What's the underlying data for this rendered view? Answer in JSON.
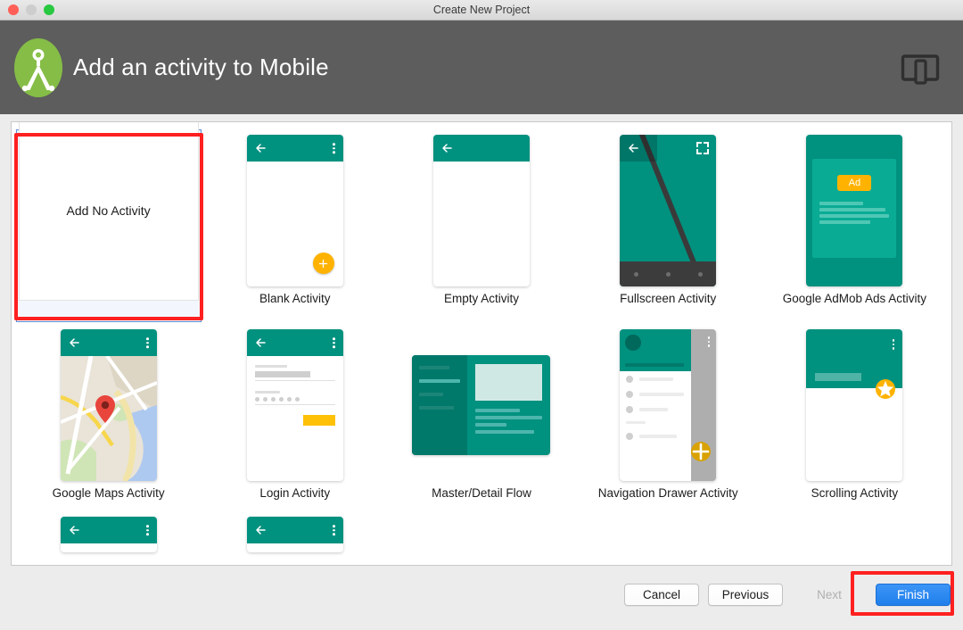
{
  "window": {
    "title": "Create New Project",
    "traffic_lights": [
      "close-red",
      "minimize-gray",
      "zoom-green"
    ]
  },
  "header": {
    "title": "Add an activity to Mobile",
    "logo_icon": "android-studio-logo",
    "device_icon": "tablet-phone-device-icon"
  },
  "gallery": {
    "selected_index": 0,
    "items": [
      {
        "label": "Add No Activity",
        "thumb": "no-activity",
        "kind": "placeholder"
      },
      {
        "label": "Blank Activity",
        "thumb": "blank-activity",
        "kind": "phone"
      },
      {
        "label": "Empty Activity",
        "thumb": "empty-activity",
        "kind": "phone"
      },
      {
        "label": "Fullscreen Activity",
        "thumb": "fullscreen-activity",
        "kind": "phone"
      },
      {
        "label": "Google AdMob Ads Activity",
        "thumb": "admob-activity",
        "kind": "phone",
        "badge": "Ad"
      },
      {
        "label": "Google Maps Activity",
        "thumb": "maps-activity",
        "kind": "phone"
      },
      {
        "label": "Login Activity",
        "thumb": "login-activity",
        "kind": "phone"
      },
      {
        "label": "Master/Detail Flow",
        "thumb": "master-detail-flow",
        "kind": "tablet"
      },
      {
        "label": "Navigation Drawer Activity",
        "thumb": "navigation-drawer-activity",
        "kind": "phone"
      },
      {
        "label": "Scrolling Activity",
        "thumb": "scrolling-activity",
        "kind": "phone"
      }
    ],
    "partial_row_count": 2
  },
  "footer": {
    "cancel_label": "Cancel",
    "previous_label": "Previous",
    "next_label": "Next",
    "next_disabled": true,
    "finish_label": "Finish"
  },
  "annotations": {
    "highlight_color": "#ff2020",
    "targets": [
      "add-no-activity-card",
      "finish-button"
    ]
  },
  "colors": {
    "teal": "#00917f",
    "teal_dark": "#00796b",
    "amber": "#ffb300",
    "header_gray": "#5d5d5d",
    "primary_blue": "#2f86ee",
    "selection_blue": "#5b8ed6"
  }
}
